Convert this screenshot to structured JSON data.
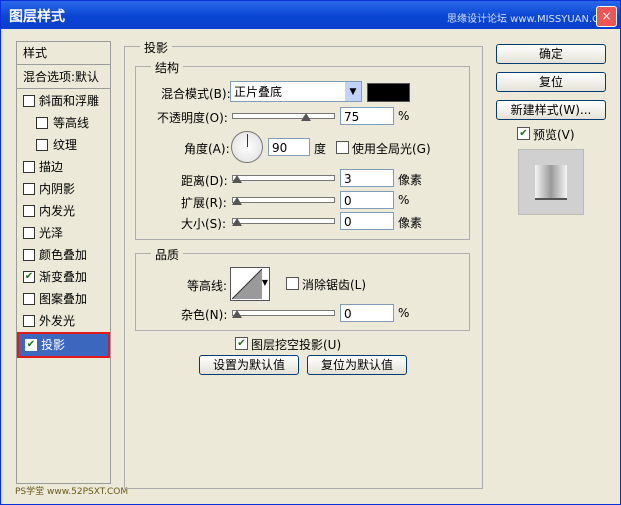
{
  "window": {
    "title": "图层样式",
    "watermark": "思缘设计论坛 www.MISSYUAN.COM",
    "close_label": "×"
  },
  "sidebar": {
    "header": "样式",
    "blend": "混合选项:默认",
    "items": [
      {
        "label": "斜面和浮雕",
        "checked": false,
        "sub": false
      },
      {
        "label": "等高线",
        "checked": false,
        "sub": true
      },
      {
        "label": "纹理",
        "checked": false,
        "sub": true
      },
      {
        "label": "描边",
        "checked": false,
        "sub": false
      },
      {
        "label": "内阴影",
        "checked": false,
        "sub": false
      },
      {
        "label": "内发光",
        "checked": false,
        "sub": false
      },
      {
        "label": "光泽",
        "checked": false,
        "sub": false
      },
      {
        "label": "颜色叠加",
        "checked": false,
        "sub": false
      },
      {
        "label": "渐变叠加",
        "checked": true,
        "sub": false
      },
      {
        "label": "图案叠加",
        "checked": false,
        "sub": false
      },
      {
        "label": "外发光",
        "checked": false,
        "sub": false
      },
      {
        "label": "投影",
        "checked": true,
        "sub": false,
        "active": true
      }
    ],
    "footer": "PS学堂 www.52PSXT.COM"
  },
  "drop_shadow": {
    "section_title": "投影",
    "structure_title": "结构",
    "blend_mode_label": "混合模式(B):",
    "blend_mode_value": "正片叠底",
    "blend_color": "#000000",
    "opacity_label": "不透明度(O):",
    "opacity_value": "75",
    "opacity_unit": "%",
    "angle_label": "角度(A):",
    "angle_value": "90",
    "angle_unit": "度",
    "global_light_label": "使用全局光(G)",
    "distance_label": "距离(D):",
    "distance_value": "3",
    "distance_unit": "像素",
    "spread_label": "扩展(R):",
    "spread_value": "0",
    "spread_unit": "%",
    "size_label": "大小(S):",
    "size_value": "0",
    "size_unit": "像素",
    "quality_title": "品质",
    "contour_label": "等高线:",
    "anti_alias_label": "消除锯齿(L)",
    "noise_label": "杂色(N):",
    "noise_value": "0",
    "noise_unit": "%",
    "knockout_label": "图层挖空投影(U)",
    "set_default_label": "设置为默认值",
    "reset_default_label": "复位为默认值"
  },
  "right": {
    "ok_label": "确定",
    "reset_label": "复位",
    "new_style_label": "新建样式(W)...",
    "preview_label": "预览(V)"
  }
}
